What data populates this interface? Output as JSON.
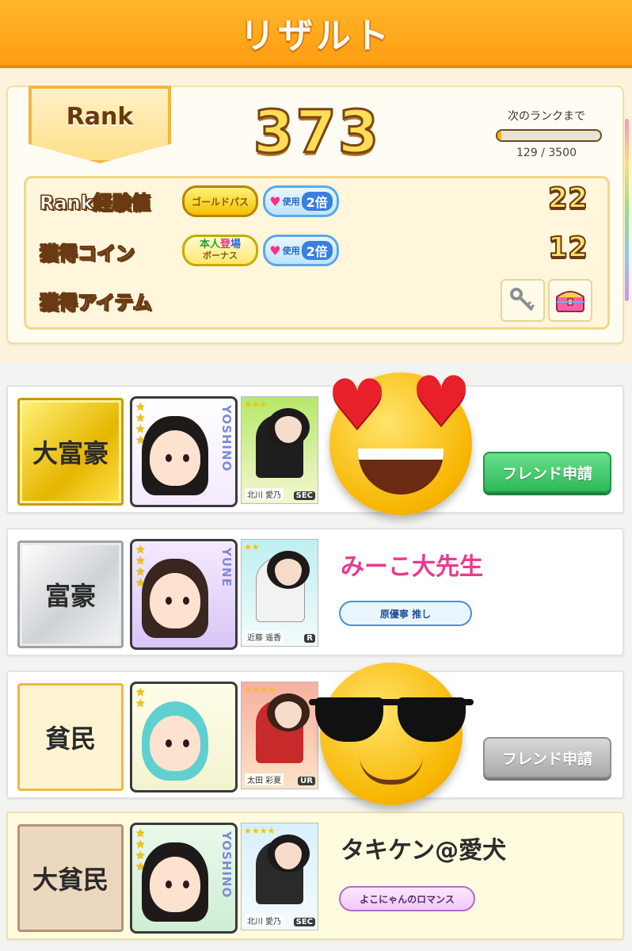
{
  "header": {
    "title": "リザルト"
  },
  "rank": {
    "badge_label": "Rank",
    "value": "373",
    "next_label": "次のランクまで",
    "next_progress": "129 / 3500",
    "progress_fraction": 0.037
  },
  "stats": {
    "exp_label": "Rank経験値",
    "exp_value": "22",
    "coin_label": "獲得コイン",
    "coin_value": "12",
    "item_label": "獲得アイテム",
    "gold_pass": "ゴールドパス",
    "double_use": "使用",
    "double_mul": "2倍",
    "bonus_top": [
      "本人",
      "登",
      "場"
    ],
    "bonus_bottom": "ボーナス",
    "items": [
      "key-icon",
      "treasure-chest-icon"
    ]
  },
  "players": [
    {
      "title": "大富豪",
      "avatar_name": "YOSHINO",
      "card_name": "北川 愛乃",
      "card_rarity": "SEC",
      "player_name": "",
      "oshi": "",
      "friend_button": "フレンド申請",
      "overlay": "heart-eyes-emoji"
    },
    {
      "title": "富豪",
      "avatar_name": "YUNE",
      "card_name": "近藤 遥香",
      "card_rarity": "R",
      "player_name": "みーこ大先生",
      "oshi": "原優寧 推し",
      "friend_button": "",
      "overlay": ""
    },
    {
      "title": "貧民",
      "avatar_name": "",
      "card_name": "太田 彩夏",
      "card_rarity": "UR",
      "player_name": "",
      "oshi": "",
      "friend_button": "フレンド申請",
      "overlay": "sunglasses-emoji"
    },
    {
      "title": "大貧民",
      "avatar_name": "YOSHINO",
      "card_name": "北川 愛乃",
      "card_rarity": "SEC",
      "player_name": "タキケン@愛犬",
      "oshi": "よこにゃんのロマンス",
      "friend_button": "",
      "overlay": ""
    }
  ],
  "colors": {
    "header": "#ffa61c",
    "name_pink": "#e83c8e",
    "name_dark": "#2b2b2b",
    "friend_green": "#2fb85a",
    "friend_gray": "#a9a9a9"
  }
}
